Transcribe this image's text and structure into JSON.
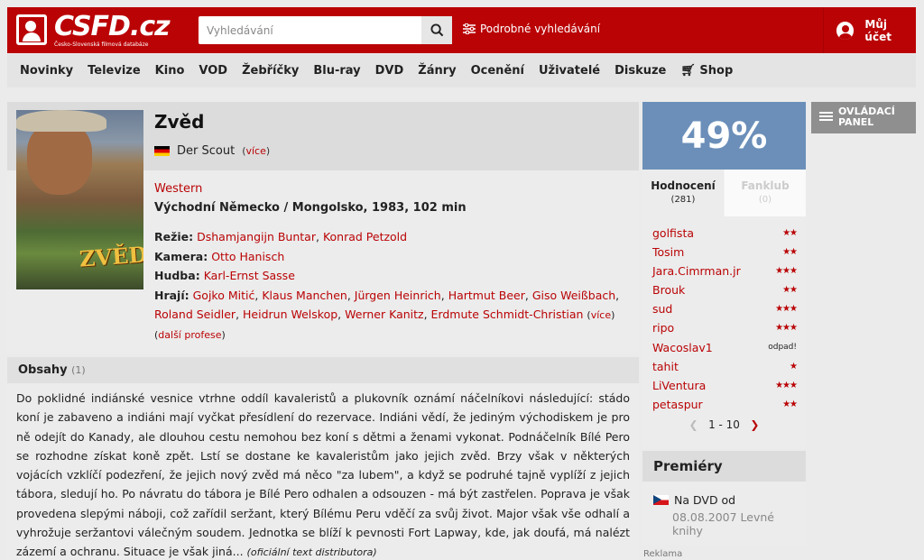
{
  "header": {
    "logo": "CSFD.cz",
    "logo_sub": "Česko-Slovenská filmová databáze",
    "search_placeholder": "Vyhledávání",
    "advanced_search": "Podrobné vyhledávání",
    "account": "Můj účet"
  },
  "nav": [
    "Novinky",
    "Televize",
    "Kino",
    "VOD",
    "Žebříčky",
    "Blu-ray",
    "DVD",
    "Žánry",
    "Ocenění",
    "Uživatelé",
    "Diskuze",
    "Shop"
  ],
  "film": {
    "title": "Zvěd",
    "original_title": "Der Scout",
    "more": "více",
    "genre": "Western",
    "origin": "Východní Německo / Mongolsko, 1983, 102 min",
    "directing_label": "Režie:",
    "directors": [
      "Dshamjangijn Buntar",
      "Konrad Petzold"
    ],
    "camera_label": "Kamera:",
    "camera": "Otto Hanisch",
    "music_label": "Hudba:",
    "music": "Karl-Ernst Sasse",
    "cast_label": "Hrají:",
    "cast": [
      "Gojko Mitić",
      "Klaus Manchen",
      "Jürgen Heinrich",
      "Hartmut Beer",
      "Giso Weißbach",
      "Roland Seidler",
      "Heidrun Welskop",
      "Werner Kanitz",
      "Erdmute Schmidt-Christian"
    ],
    "cast_more": "více",
    "more_professions": "další profese",
    "poster_text": "ZVĚD"
  },
  "plot": {
    "heading": "Obsahy",
    "count": "(1)",
    "text": "Do poklidné indiánské vesnice vtrhne oddíl kavaleristů a plukovník oznámí náčelníkovi následující: stádo koní je zabaveno a indiáni mají vyčkat přesídlení do rezervace. Indiáni vědí, že jediným východiskem je pro ně odejít do Kanady, ale dlouhou cestu nemohou bez koní s dětmi a ženami vykonat. Podnáčelník Bílé Pero se rozhodne získat koně zpět. Lstí se dostane ke kavaleristům jako jejich zvěd. Brzy však v některých vojácích vzklíčí podezření, že jejich nový zvěd má něco \"za lubem\", a když se podruhé tajně vyplíží z jejich tábora, sledují ho. Po návratu do tábora je Bílé Pero odhalen a odsouzen - má být zastřelen. Poprava je však provedena slepými náboji, což zařídil seržant, který Bílému Peru vděčí za svůj život. Major však vše odhalí a vyhrožuje seržantovi válečným soudem. Jednotka se blíží k pevnosti Fort Lapway, kde, jak doufá, má nalézt zázemí a ochranu. Situace je však jiná...",
    "source": "(oficiální text distributora)"
  },
  "rating": {
    "percent": "49%",
    "tab_ratings": "Hodnocení",
    "tab_ratings_count": "(281)",
    "tab_fanclub": "Fanklub",
    "tab_fanclub_count": "(0)",
    "users": [
      {
        "name": "golfista",
        "stars": 2
      },
      {
        "name": "Tosim",
        "stars": 2
      },
      {
        "name": "Jara.Cimrman.jr",
        "stars": 3
      },
      {
        "name": "Brouk",
        "stars": 2
      },
      {
        "name": "sud",
        "stars": 3
      },
      {
        "name": "ripo",
        "stars": 3
      },
      {
        "name": "Wacoslav1",
        "stars": 0,
        "label": "odpad!"
      },
      {
        "name": "tahit",
        "stars": 1
      },
      {
        "name": "LiVentura",
        "stars": 3
      },
      {
        "name": "petaspur",
        "stars": 2
      }
    ],
    "pager": "1 - 10"
  },
  "premieres": {
    "heading": "Premiéry",
    "row": "Na DVD od",
    "detail": "08.08.2007 Levné knihy"
  },
  "ad_label": "Reklama",
  "panel_button": "OVLÁDACÍ PANEL"
}
